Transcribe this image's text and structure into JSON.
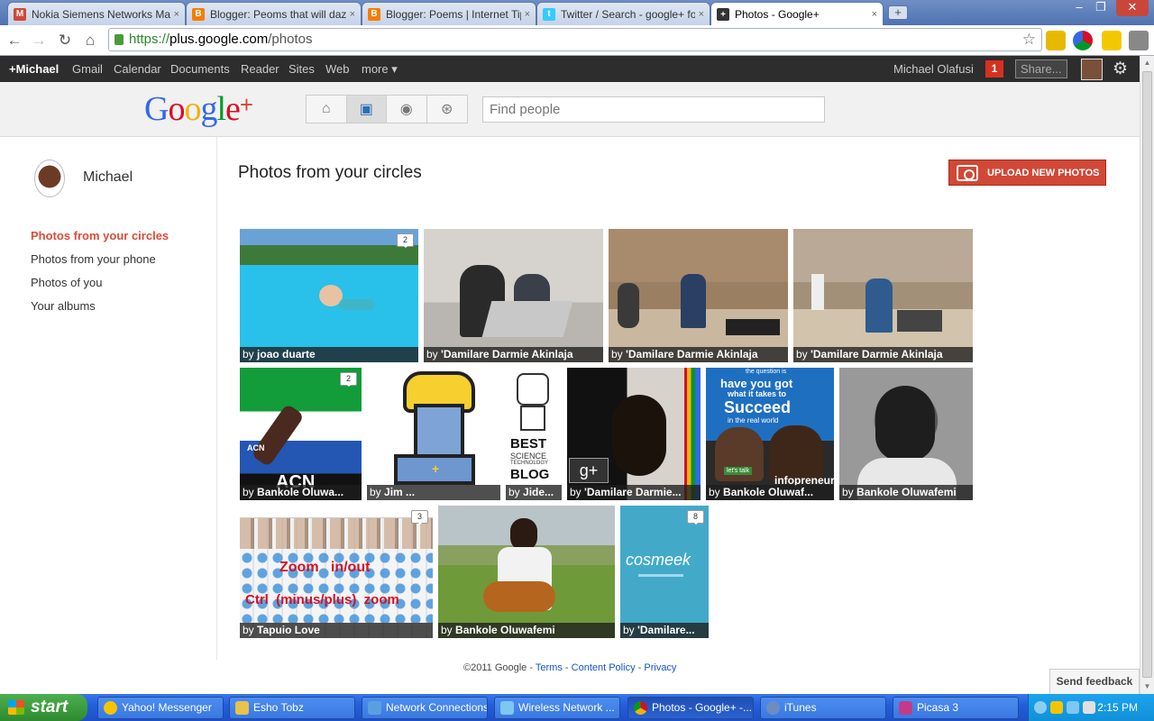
{
  "browser": {
    "tabs": [
      {
        "label": "Nokia Siemens Networks Mail",
        "icon": "gmail-icon",
        "color": "#d14836"
      },
      {
        "label": "Blogger: Peoms that will daze",
        "icon": "blogger-icon",
        "color": "#f57d00"
      },
      {
        "label": "Blogger: Poems | Internet Tip",
        "icon": "blogger-icon",
        "color": "#f57d00"
      },
      {
        "label": "Twitter / Search - google+ for",
        "icon": "twitter-icon",
        "color": "#33ccff"
      },
      {
        "label": "Photos - Google+",
        "icon": "google-plus-icon",
        "color": "#333333"
      }
    ],
    "close_glyph": "×",
    "new_tab_glyph": "+",
    "window_buttons": [
      "–",
      "❐",
      "✕"
    ],
    "url_scheme": "https://",
    "url_host": "plus.google.com",
    "url_path": "/photos",
    "nav_glyphs": {
      "back": "←",
      "forward": "→",
      "reload": "↻",
      "home": "⌂",
      "star": "☆"
    }
  },
  "gbar": {
    "items": [
      "+Michael",
      "Gmail",
      "Calendar",
      "Documents",
      "Reader",
      "Sites",
      "Web",
      "more ▾"
    ],
    "user_name": "Michael Olafusi",
    "notifications": "1",
    "share": "Share...",
    "gear": "⚙"
  },
  "header": {
    "logo_letters": [
      {
        "ch": "G",
        "color": "#3369e8"
      },
      {
        "ch": "o",
        "color": "#d50f25"
      },
      {
        "ch": "o",
        "color": "#eeb211"
      },
      {
        "ch": "g",
        "color": "#3369e8"
      },
      {
        "ch": "l",
        "color": "#009925"
      },
      {
        "ch": "e",
        "color": "#d50f25"
      }
    ],
    "logo_plus": "+",
    "nav_icons": [
      "home-icon",
      "photos-icon",
      "profile-icon",
      "circles-icon"
    ],
    "nav_glyphs": [
      "⌂",
      "▣",
      "◉",
      "⊛"
    ],
    "search_placeholder": "Find people"
  },
  "sidebar": {
    "name": "Michael",
    "items": [
      {
        "label": "Photos from your circles",
        "active": true
      },
      {
        "label": "Photos from your phone",
        "active": false
      },
      {
        "label": "Photos of you",
        "active": false
      },
      {
        "label": "Your albums",
        "active": false
      }
    ]
  },
  "main": {
    "title": "Photos from your circles",
    "upload_label": "UPLOAD NEW PHOTOS",
    "photos": [
      {
        "by": "by",
        "author": "joao duarte",
        "count": "2",
        "art": "pool"
      },
      {
        "by": "by",
        "author": "'Damilare Darmie Akinlaja",
        "count": "",
        "art": "office"
      },
      {
        "by": "by",
        "author": "'Damilare Darmie Akinlaja",
        "count": "",
        "art": "hall"
      },
      {
        "by": "by",
        "author": "'Damilare Darmie Akinlaja",
        "count": "",
        "art": "hall2"
      },
      {
        "by": "by",
        "author": "Bankole Oluwa...",
        "count": "2",
        "art": "flag"
      },
      {
        "by": "by",
        "author": "Jim ...",
        "count": "",
        "art": "pixel"
      },
      {
        "by": "by",
        "author": "Jide...",
        "count": "",
        "art": "blog"
      },
      {
        "by": "by",
        "author": "'Damilare Darmie...",
        "count": "",
        "art": "gplus"
      },
      {
        "by": "by",
        "author": "Bankole Oluwaf...",
        "count": "",
        "art": "poster"
      },
      {
        "by": "by",
        "author": "Bankole Oluwafemi",
        "count": "",
        "art": "portrait"
      },
      {
        "by": "by",
        "author": "Tapuio Love",
        "count": "3",
        "art": "screenshot"
      },
      {
        "by": "by",
        "author": "Bankole Oluwafemi",
        "count": "",
        "art": "guitar"
      },
      {
        "by": "by",
        "author": "'Damilare...",
        "count": "8",
        "art": "cosmeek"
      }
    ],
    "art_text": {
      "acn": "ACN",
      "best": "BEST",
      "science": "SCIENCE",
      "technology": "TECHNOLOGY",
      "blog": "BLOG",
      "gplus_mark": "g+",
      "poster_top": "the question is",
      "poster_have": "have you got",
      "poster_takes": "what it takes to",
      "poster_succeed": "Succeed",
      "poster_world": "in the real world",
      "poster_lets": "let's talk",
      "poster_info": "infopreneur",
      "zoom_line1": "Zoom   in/out",
      "zoom_line2": "Ctrl  (minus/plus)  zoom",
      "cosmeek": "cosmeek"
    }
  },
  "footer": {
    "copyright": "©2011 Google",
    "sep": "-",
    "terms": "Terms",
    "content_policy": "Content Policy",
    "privacy": "Privacy"
  },
  "feedback": "Send feedback",
  "taskbar": {
    "start": "start",
    "items": [
      {
        "label": "Yahoo! Messenger",
        "color": "#f5c400"
      },
      {
        "label": "Esho Tobz",
        "color": "#e8c24a"
      },
      {
        "label": "Network Connections",
        "color": "#5aa0e0"
      },
      {
        "label": "Wireless Network ...",
        "color": "#7ec7f0"
      },
      {
        "label": "Photos - Google+ -...",
        "color": "#e04a3a"
      },
      {
        "label": "iTunes",
        "color": "#6d8dbf"
      },
      {
        "label": "Picasa 3",
        "color": "#c23b8a"
      }
    ],
    "clock": "2:15 PM"
  }
}
